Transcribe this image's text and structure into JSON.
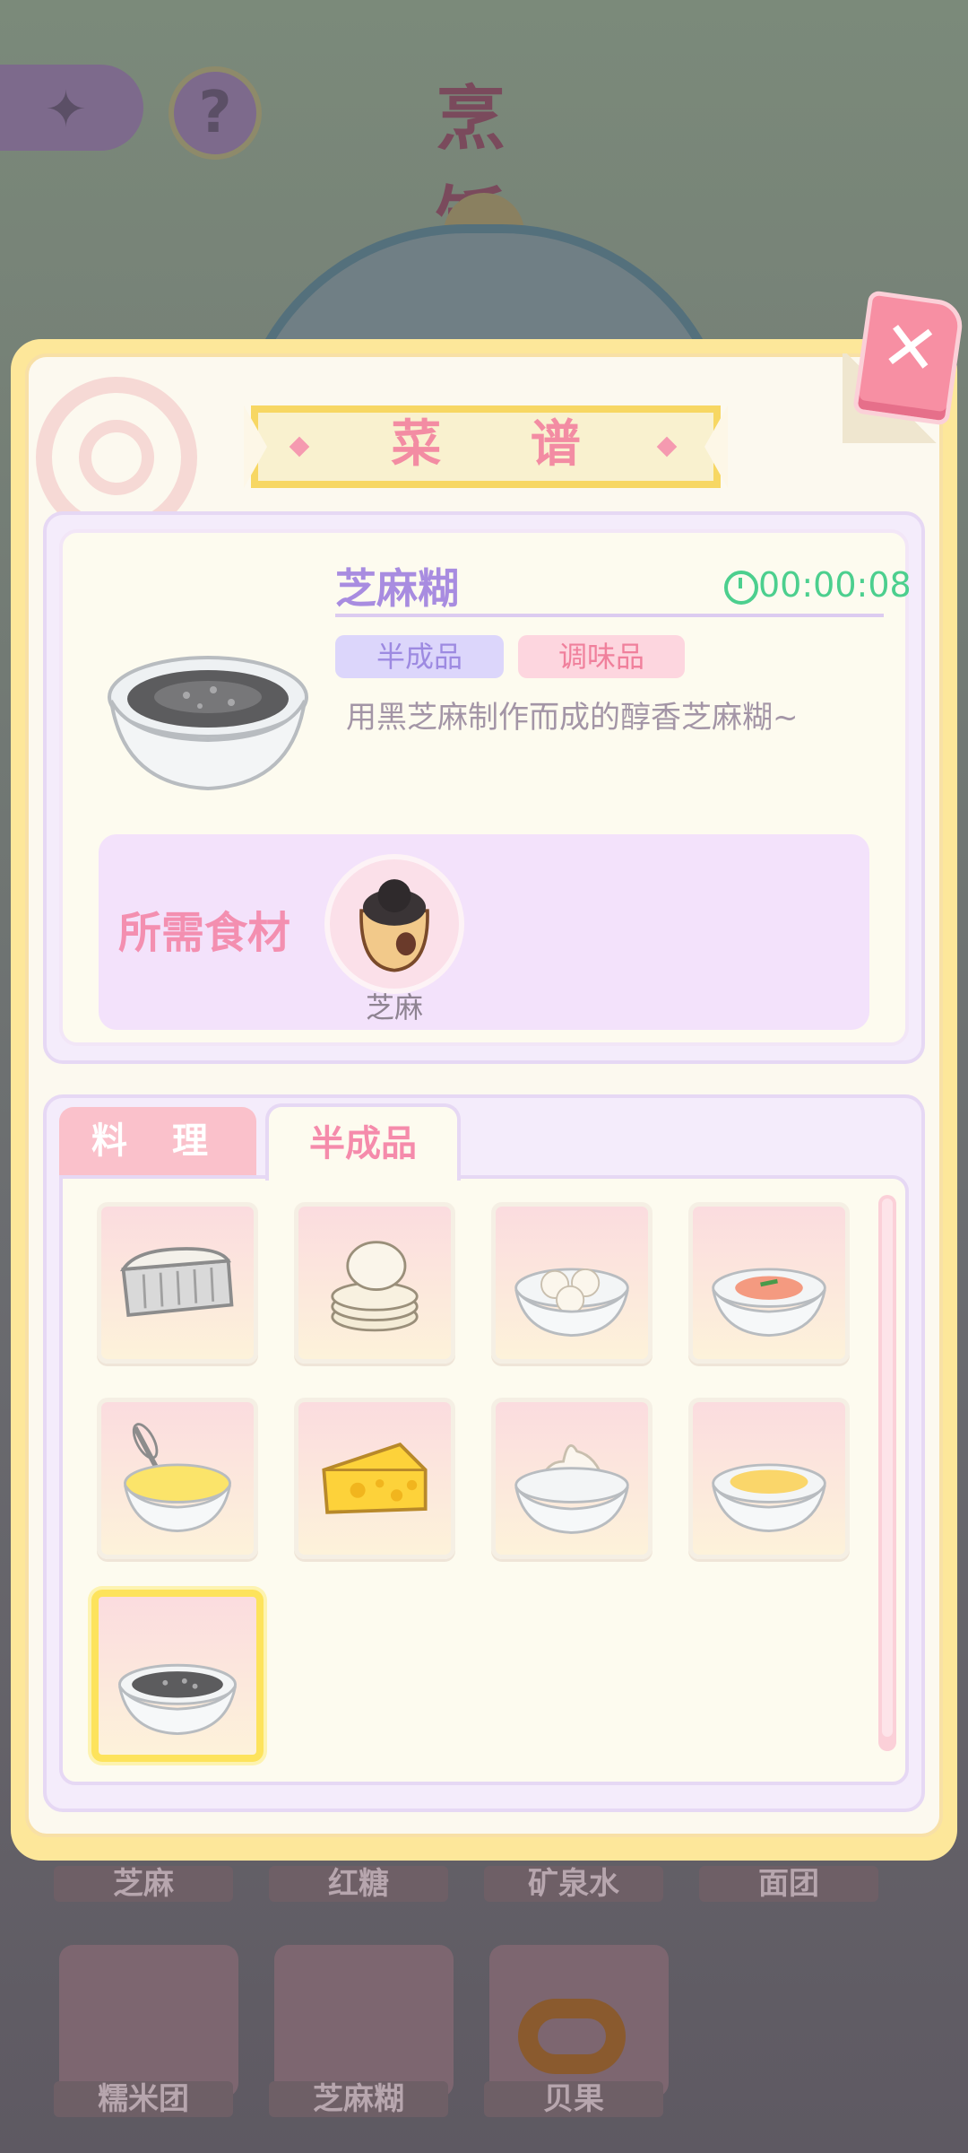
{
  "background": {
    "title": "烹 饪",
    "shelf_labels_row1": [
      "芝麻",
      "红糖",
      "矿泉水",
      "面团"
    ],
    "shelf_labels_row2": [
      "糯米团",
      "芝麻糊",
      "贝果"
    ]
  },
  "panel": {
    "title": "菜 谱",
    "close_glyph": "✕"
  },
  "recipe": {
    "name": "芝麻糊",
    "time": "00:00:08",
    "tags": [
      "半成品",
      "调味品"
    ],
    "description": "用黑芝麻制作而成的醇香芝麻糊~",
    "ingredients_label": "所需食材",
    "ingredient": {
      "name": "芝麻",
      "icon": "sesame-sack-icon"
    }
  },
  "tabs": [
    {
      "label": "料 理",
      "active": false
    },
    {
      "label": "半成品",
      "active": true
    }
  ],
  "grid_items": [
    {
      "icon": "bread-loaf-icon"
    },
    {
      "icon": "flatbread-stack-icon"
    },
    {
      "icon": "rice-balls-bowl-icon"
    },
    {
      "icon": "shrimp-bowl-icon"
    },
    {
      "icon": "whisked-egg-bowl-icon"
    },
    {
      "icon": "cheese-wedge-icon"
    },
    {
      "icon": "cream-bowl-icon"
    },
    {
      "icon": "custard-bowl-icon"
    },
    {
      "icon": "sesame-paste-bowl-icon",
      "selected": true
    }
  ],
  "colors": {
    "accent_pink": "#f38ca3",
    "accent_purple": "#a88ce0",
    "timer_green": "#4ccf8e",
    "panel_yellow": "#fde79a"
  }
}
